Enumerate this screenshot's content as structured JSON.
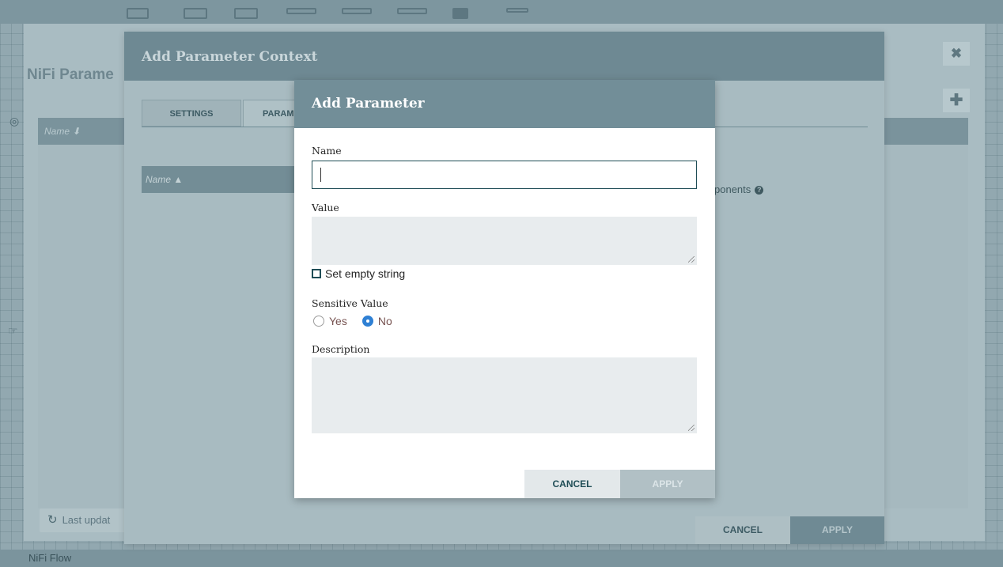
{
  "background": {
    "breadcrumb": "NiFi Flow"
  },
  "outer_dialog": {
    "title": "NiFi Parame",
    "table_header": "Name ⬇",
    "refresh_label": "Last updat",
    "close_icon": "✖",
    "add_icon": "✚"
  },
  "context_dialog": {
    "title": "Add Parameter Context",
    "tabs": [
      {
        "label": "SETTINGS"
      },
      {
        "label": "PARAMETERS"
      }
    ],
    "grid_header": "Name ▲",
    "components_label": "ponents",
    "help_icon": "?",
    "cancel_label": "CANCEL",
    "apply_label": "APPLY"
  },
  "add_parameter": {
    "title": "Add Parameter",
    "name_label": "Name",
    "name_value": "",
    "value_label": "Value",
    "value_text": "",
    "empty_string_label": "Set empty string",
    "sensitive_label": "Sensitive Value",
    "sensitive_options": [
      {
        "label": "Yes",
        "selected": false
      },
      {
        "label": "No",
        "selected": true
      }
    ],
    "description_label": "Description",
    "description_text": "",
    "cancel_label": "CANCEL",
    "apply_label": "APPLY"
  },
  "colors": {
    "header_bg": "#728e98",
    "accent": "#1f4d56",
    "radio_selected": "#2f80d4",
    "radio_label": "#775351"
  }
}
